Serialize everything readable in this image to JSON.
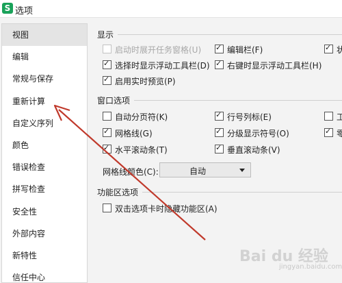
{
  "window": {
    "icon_letter": "S",
    "title": "选项"
  },
  "sidebar": {
    "items": [
      {
        "label": "视图",
        "active": true
      },
      {
        "label": "编辑"
      },
      {
        "label": "常规与保存"
      },
      {
        "label": "重新计算"
      },
      {
        "label": "自定义序列"
      },
      {
        "label": "颜色"
      },
      {
        "label": "错误检查"
      },
      {
        "label": "拼写检查"
      },
      {
        "label": "安全性"
      },
      {
        "label": "外部内容"
      },
      {
        "label": "新特性"
      },
      {
        "label": "信任中心"
      }
    ]
  },
  "display": {
    "heading": "显示",
    "options": [
      {
        "label": "启动时展开任务窗格(U)",
        "checked": false,
        "disabled": true
      },
      {
        "label": "编辑栏(F)",
        "checked": true
      },
      {
        "label": "状",
        "checked": true
      },
      {
        "label": "选择时显示浮动工具栏(D)",
        "checked": true
      },
      {
        "label": "右键时显示浮动工具栏(H)",
        "checked": true
      },
      {
        "label": "启用实时预览(P)",
        "checked": true
      }
    ]
  },
  "window_options": {
    "heading": "窗口选项",
    "options": [
      {
        "label": "自动分页符(K)",
        "checked": false
      },
      {
        "label": "行号列标(E)",
        "checked": true
      },
      {
        "label": "工",
        "checked": false
      },
      {
        "label": "网格线(G)",
        "checked": true
      },
      {
        "label": "分级显示符号(O)",
        "checked": true
      },
      {
        "label": "零",
        "checked": true
      },
      {
        "label": "水平滚动条(T)",
        "checked": true
      },
      {
        "label": "垂直滚动条(V)",
        "checked": true
      }
    ],
    "grid_color": {
      "label": "网格线颜色(C):",
      "value": "自动"
    }
  },
  "ribbon": {
    "heading": "功能区选项",
    "options": [
      {
        "label": "双击选项卡时隐藏功能区(A)",
        "checked": false
      }
    ]
  },
  "watermark": {
    "text": "Bai du 经验",
    "sub": "jingyan.baidu.com"
  },
  "colors": {
    "arrow": "#c0392b",
    "app_icon": "#1aa25a",
    "active_item": "#e4e4e4"
  }
}
